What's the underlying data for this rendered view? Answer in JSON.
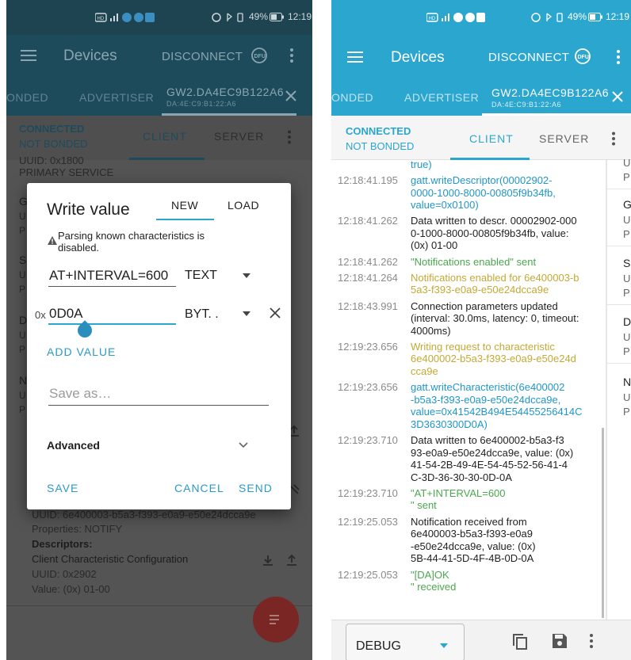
{
  "left": {
    "status": {
      "time": "12:19",
      "battery": "49%"
    },
    "appbar": {
      "title": "Devices",
      "disconnect": "DISCONNECT",
      "dfu": "DFU"
    },
    "tabs": {
      "bonded": "ONDED",
      "advertiser": "ADVERTISER",
      "device_name": "GW2.DA4EC9B122A6",
      "device_mac": "DA:4E:C9:B1:22:A6"
    },
    "conn": {
      "connected": "CONNECTED",
      "not_bonded": "NOT BONDED",
      "client": "CLIENT",
      "server": "SERVER"
    },
    "bg": {
      "uuid_top": "UUID: 0x1800",
      "primary_service": "PRIMARY SERVICE",
      "partial_letters": [
        "G",
        "U",
        "P",
        "S",
        "U",
        "P",
        "D",
        "U",
        "P",
        "N",
        "U",
        "P"
      ],
      "char_uuid": "UUID: 6e400003-b5a3-f393-e0a9-e50e24dcca9e",
      "properties": "Properties: NOTIFY",
      "descriptors": "Descriptors:",
      "cccd": "Client Characteristic Configuration",
      "desc_uuid": "UUID: 0x2902",
      "desc_value": "Value: (0x) 01-00"
    },
    "dialog": {
      "title": "Write value",
      "tab_new": "NEW",
      "tab_load": "LOAD",
      "warning": "Parsing known characteristics is disabled.",
      "value1": "AT+INTERVAL=600",
      "type1": "TEXT",
      "prefix2": "0x",
      "value2": "0D0A",
      "type2": "BYT. .",
      "add_value": "ADD VALUE",
      "save_as_placeholder": "Save as…",
      "advanced": "Advanced",
      "save": "SAVE",
      "cancel": "CANCEL",
      "send": "SEND"
    }
  },
  "right": {
    "status": {
      "time": "12:19",
      "battery": "49%"
    },
    "appbar": {
      "title": "Devices",
      "disconnect": "DISCONNECT",
      "dfu": "DFU"
    },
    "tabs": {
      "bonded": "ONDED",
      "advertiser": "ADVERTISER",
      "device_name": "GW2.DA4EC9B122A6",
      "device_mac": "DA:4E:C9:B1:22:A6"
    },
    "conn": {
      "connected": "CONNECTED",
      "not_bonded": "NOT BONDED",
      "client": "CLIENT",
      "server": "SERVER"
    },
    "log": [
      {
        "time": "",
        "color": "#2196c9",
        "lines": [
          "true)"
        ]
      },
      {
        "time": "12:18:41.195",
        "color": "#2196c9",
        "lines": [
          "gatt.writeDescriptor(00002902-",
          "0000-1000-8000-00805f9b34fb,",
          "value=0x0100)"
        ]
      },
      {
        "time": "12:18:41.262",
        "color": "#222222",
        "lines": [
          "Data written to descr. 00002902-000",
          "0-1000-8000-00805f9b34fb, value:",
          "(0x) 01-00"
        ]
      },
      {
        "time": "12:18:41.262",
        "color": "#4aa84e",
        "lines": [
          "\"Notifications enabled\" sent"
        ]
      },
      {
        "time": "12:18:41.264",
        "color": "#c4a935",
        "lines": [
          "Notifications enabled for 6e400003-b",
          "5a3-f393-e0a9-e50e24dcca9e"
        ]
      },
      {
        "time": "12:18:43.991",
        "color": "#222222",
        "lines": [
          "Connection parameters updated",
          "(interval: 30.0ms, latency: 0, timeout:",
          "4000ms)"
        ]
      },
      {
        "time": "12:19:23.656",
        "color": "#c4a935",
        "lines": [
          "Writing request to characteristic",
          "6e400002-b5a3-f393-e0a9-e50e24d",
          "cca9e"
        ]
      },
      {
        "time": "12:19:23.656",
        "color": "#2196c9",
        "lines": [
          "gatt.writeCharacteristic(6e400002",
          "-b5a3-f393-e0a9-e50e24dcca9e,",
          "value=0x41542B494E54455256414C",
          "3D3630300D0A)"
        ]
      },
      {
        "time": "12:19:23.710",
        "color": "#222222",
        "lines": [
          "Data written to 6e400002-b5a3-f3",
          "93-e0a9-e50e24dcca9e, value: (0x)",
          "41-54-2B-49-4E-54-45-52-56-41-4",
          "C-3D-36-30-30-0D-0A"
        ]
      },
      {
        "time": "12:19:23.710",
        "color": "#4aa84e",
        "lines": [
          "\"AT+INTERVAL=600",
          "\" sent"
        ]
      },
      {
        "time": "12:19:25.053",
        "color": "#222222",
        "lines": [
          "Notification received from",
          "6e400003-b5a3-f393-e0a9",
          "-e50e24dcca9e, value: (0x)",
          "5B-44-41-5D-4F-4B-0D-0A"
        ]
      },
      {
        "time": "12:19:25.053",
        "color": "#4aa84e",
        "lines": [
          "\"[DA]OK",
          "\" received"
        ]
      }
    ],
    "side_letters": [
      "U",
      "P",
      "G",
      "U",
      "P",
      "S",
      "U",
      "P",
      "D",
      "U",
      "P",
      "N",
      "U",
      "P"
    ],
    "bottom": {
      "level": "DEBUG"
    },
    "colors": {
      "primary": "#2aa6cf",
      "accent": "#e53935",
      "blue_text": "#2196c9",
      "green_text": "#4aa84e",
      "gold_text": "#c4a935"
    }
  }
}
